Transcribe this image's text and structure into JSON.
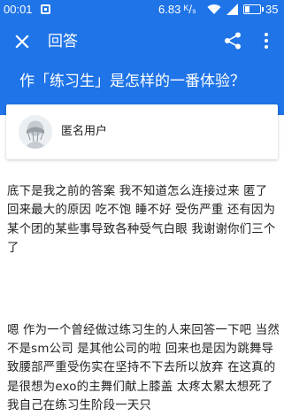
{
  "status_bar": {
    "time": "00:01",
    "net_speed": "6.83 ᴷ/ₛ",
    "battery_percent": "35",
    "battery_level": 0.35,
    "icons": [
      "notification-icon",
      "wifi-icon",
      "signal-icon",
      "battery-icon"
    ]
  },
  "app_bar": {
    "title": "回答",
    "background_color": "#1f74e8",
    "icons": [
      "close-icon",
      "share-icon",
      "more-vert-icon"
    ]
  },
  "question": {
    "title": "作「练习生」是怎样的一番体验？"
  },
  "author": {
    "name": "匿名用户",
    "avatar_icon": "anonymous-avatar-icon"
  },
  "answer": {
    "paragraphs": [
      "底下是我之前的答案 我不知道怎么连接过来 匿了 回来最大的原因 吃不饱 睡不好 受伤严重 还有因为某个团的某些事导致各种受气白眼 我谢谢你们三个了",
      "嗯 作为一个曾经做过练习生的人来回答一下吧 当然不是sm公司 是其他公司的啦 回来也是因为跳舞导致腰部严重受伤实在坚持不下去所以放弃 在这真的是很想为exo的主舞们献上膝盖 太疼太累太想死了 我自己在练习生阶段一天只"
    ]
  }
}
